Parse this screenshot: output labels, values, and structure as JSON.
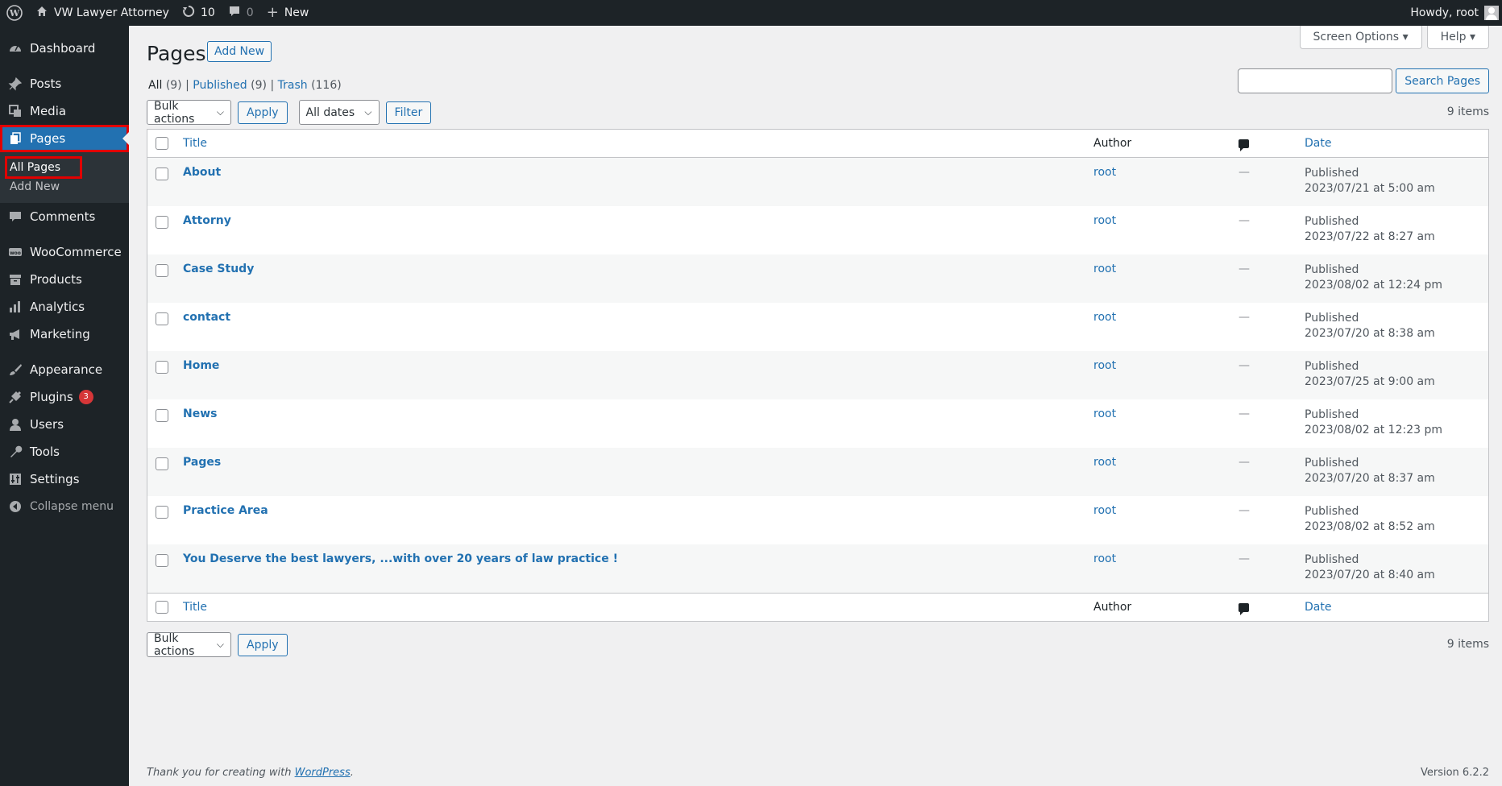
{
  "adminbar": {
    "site_name": "VW Lawyer Attorney",
    "updates": "10",
    "comments": "0",
    "new_label": "New",
    "howdy": "Howdy, root"
  },
  "sidebar": {
    "items": [
      {
        "label": "Dashboard"
      },
      {
        "label": "Posts"
      },
      {
        "label": "Media"
      },
      {
        "label": "Pages"
      },
      {
        "label": "Comments"
      },
      {
        "label": "WooCommerce"
      },
      {
        "label": "Products"
      },
      {
        "label": "Analytics"
      },
      {
        "label": "Marketing"
      },
      {
        "label": "Appearance"
      },
      {
        "label": "Plugins",
        "badge": "3"
      },
      {
        "label": "Users"
      },
      {
        "label": "Tools"
      },
      {
        "label": "Settings"
      }
    ],
    "submenu": [
      "All Pages",
      "Add New"
    ],
    "collapse": "Collapse menu"
  },
  "header": {
    "title": "Pages",
    "add_new": "Add New",
    "screen_options": "Screen Options",
    "help": "Help"
  },
  "filters": {
    "all": "All",
    "all_count": "(9)",
    "published": "Published",
    "published_count": "(9)",
    "trash": "Trash",
    "trash_count": "(116)",
    "bulk_actions": "Bulk actions",
    "apply": "Apply",
    "all_dates": "All dates",
    "filter": "Filter",
    "search_button": "Search Pages",
    "items_count": "9 items"
  },
  "table": {
    "columns": {
      "title": "Title",
      "author": "Author",
      "date": "Date"
    },
    "rows": [
      {
        "title": "About",
        "author": "root",
        "comments": "—",
        "status": "Published",
        "date": "2023/07/21 at 5:00 am"
      },
      {
        "title": "Attorny",
        "author": "root",
        "comments": "—",
        "status": "Published",
        "date": "2023/07/22 at 8:27 am"
      },
      {
        "title": "Case Study",
        "author": "root",
        "comments": "—",
        "status": "Published",
        "date": "2023/08/02 at 12:24 pm"
      },
      {
        "title": "contact",
        "author": "root",
        "comments": "—",
        "status": "Published",
        "date": "2023/07/20 at 8:38 am"
      },
      {
        "title": "Home",
        "author": "root",
        "comments": "—",
        "status": "Published",
        "date": "2023/07/25 at 9:00 am"
      },
      {
        "title": "News",
        "author": "root",
        "comments": "—",
        "status": "Published",
        "date": "2023/08/02 at 12:23 pm"
      },
      {
        "title": "Pages",
        "author": "root",
        "comments": "—",
        "status": "Published",
        "date": "2023/07/20 at 8:37 am"
      },
      {
        "title": "Practice Area",
        "author": "root",
        "comments": "—",
        "status": "Published",
        "date": "2023/08/02 at 8:52 am"
      },
      {
        "title": "You Deserve the best lawyers, ...with over 20 years of law practice !",
        "author": "root",
        "comments": "—",
        "status": "Published",
        "date": "2023/07/20 at 8:40 am"
      }
    ]
  },
  "footer": {
    "thanks": "Thank you for creating with",
    "wp_link": "WordPress",
    "period": ".",
    "version": "Version 6.2.2"
  }
}
